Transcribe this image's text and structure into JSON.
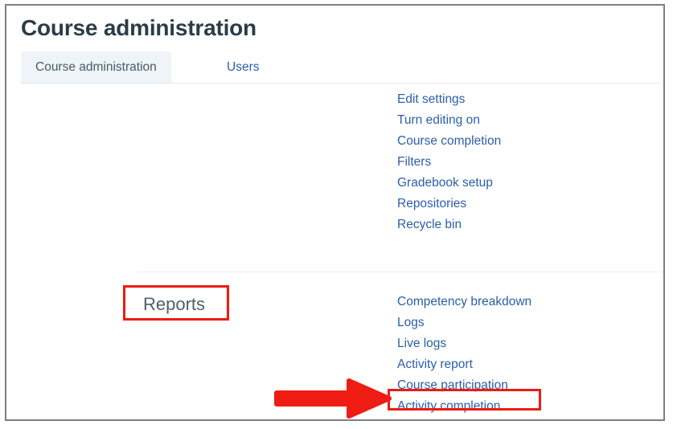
{
  "page": {
    "title": "Course administration"
  },
  "tabs": [
    {
      "label": "Course administration",
      "state": "active"
    },
    {
      "label": "Users",
      "state": "inactive"
    }
  ],
  "sections": [
    {
      "name": "course-settings",
      "heading": "",
      "links": [
        "Edit settings",
        "Turn editing on",
        "Course completion",
        "Filters",
        "Gradebook setup",
        "Repositories",
        "Recycle bin"
      ]
    },
    {
      "name": "reports",
      "heading": "Reports",
      "links": [
        "Competency breakdown",
        "Logs",
        "Live logs",
        "Activity report",
        "Course participation",
        "Activity completion"
      ]
    }
  ],
  "annotations": {
    "color": "#ee1c12",
    "highlight_boxes": [
      {
        "target": "Reports"
      },
      {
        "target": "Activity completion"
      }
    ],
    "arrow": {
      "points_to": "Activity completion",
      "direction": "right"
    }
  },
  "colors": {
    "link": "#2b5ea8",
    "title": "#2b3c47",
    "active_tab_bg": "#eef4f8",
    "frame_border": "#7c7f83",
    "annotation_red": "#ee1c12"
  }
}
